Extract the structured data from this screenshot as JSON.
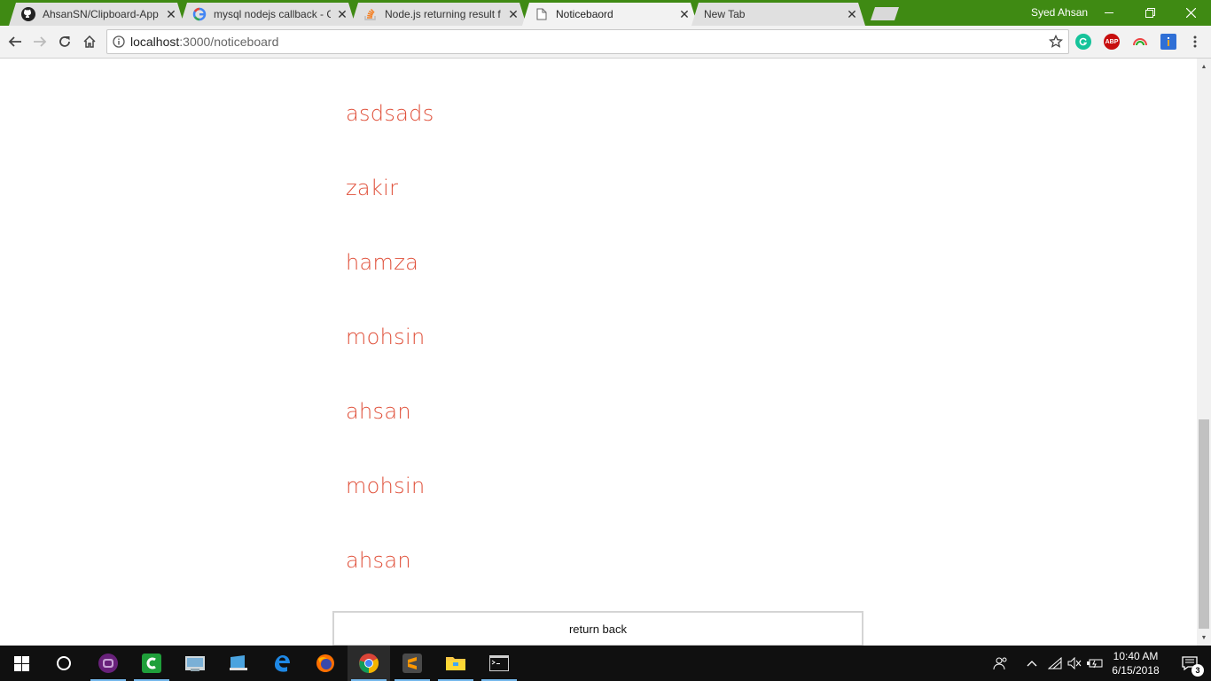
{
  "browser": {
    "tabs": [
      {
        "title": "AhsanSN/Clipboard-App",
        "favicon": "github-icon",
        "active": false
      },
      {
        "title": "mysql nodejs callback - G",
        "favicon": "google-icon",
        "active": false
      },
      {
        "title": "Node.js returning result f",
        "favicon": "stackoverflow-icon",
        "active": false
      },
      {
        "title": "Noticebaord",
        "favicon": "page-icon",
        "active": true
      },
      {
        "title": "New Tab",
        "favicon": "",
        "active": false
      }
    ],
    "profile_name": "Syed Ahsan",
    "url_host": "localhost",
    "url_path": ":3000/noticeboard",
    "extensions": [
      "grammarly-icon",
      "adblock-plus-icon",
      "rainbow-extension-icon",
      "blue-extension-icon"
    ],
    "abp_label": "ABP"
  },
  "page": {
    "notices": [
      "asdsads",
      "zakir",
      "hamza",
      "mohsin",
      "ahsan",
      "mohsin",
      "ahsan"
    ],
    "return_label": "return back"
  },
  "taskbar": {
    "time": "10:40 AM",
    "date": "6/15/2018",
    "notification_count": "3",
    "apps": [
      "windows-start-icon",
      "cortana-icon",
      "visual-studio-icon",
      "camtasia-icon",
      "file-manager-icon",
      "remote-desktop-icon",
      "edge-icon",
      "firefox-icon",
      "chrome-icon",
      "sublime-text-icon",
      "file-explorer-icon",
      "terminal-icon"
    ]
  },
  "colors": {
    "titlebar": "#3f8a13",
    "notice_text": "#e0513b",
    "taskbar": "#101010"
  }
}
